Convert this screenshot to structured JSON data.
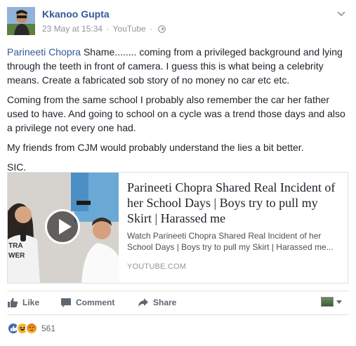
{
  "post": {
    "author": "Kkanoo Gupta",
    "date": "23 May at 15:34",
    "separator": "·",
    "source": "YouTube",
    "separator2": "·",
    "audience_icon": "globe-icon",
    "menu_icon": "chevron-down-icon"
  },
  "body": {
    "mention": "Parineeti Chopra",
    "p1_rest": " Shame........ coming from a privileged background and lying through the teeth in front of camera. I guess this is what being a celebrity means. Create a fabricated sob story of no money no car etc etc.",
    "p2": "Coming from the same school I probably also remember the car her father used to have. And going to school on a cycle was a trend those days and also a privilege not every one had.",
    "p3": "My friends from CJM would probably understand the lies a bit better.",
    "p4": "SIC."
  },
  "link_card": {
    "title": "Parineeti Chopra Shared Real Incident of her School Days | Boys try to pull my Skirt | Harassed me",
    "desc_line1": "Watch Parineeti Chopra Shared Real Incident of her",
    "desc_line2": "School Days | Boys try to pull my Skirt | Harassed me...",
    "domain": "YOUTUBE.COM",
    "thumb_text_1": "TRA",
    "thumb_text_2": "WER",
    "play_icon": "play-icon"
  },
  "actions": {
    "like": "Like",
    "comment": "Comment",
    "share": "Share"
  },
  "reactions": {
    "types": [
      "like",
      "haha",
      "angry"
    ],
    "count": "561"
  },
  "colors": {
    "link": "#365899",
    "meta": "#90949c",
    "action": "#606770",
    "like_blue": "#4267b2"
  }
}
